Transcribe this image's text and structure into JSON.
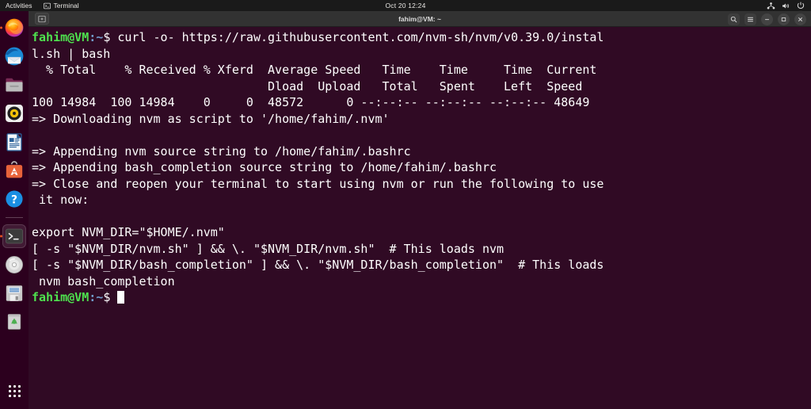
{
  "topbar": {
    "activities": "Activities",
    "app_name": "Terminal",
    "clock": "Oct 20  12:24",
    "indicators": [
      "network-icon",
      "volume-icon",
      "power-icon"
    ]
  },
  "dock": {
    "items": [
      {
        "name": "firefox",
        "label": "Firefox",
        "running": true,
        "active": false
      },
      {
        "name": "thunderbird",
        "label": "Thunderbird",
        "running": false,
        "active": false
      },
      {
        "name": "files",
        "label": "Files",
        "running": false,
        "active": false
      },
      {
        "name": "rhythmbox",
        "label": "Rhythmbox",
        "running": false,
        "active": false
      },
      {
        "name": "libreoffice-writer",
        "label": "LibreOffice Writer",
        "running": false,
        "active": false
      },
      {
        "name": "ubuntu-software",
        "label": "Ubuntu Software",
        "running": false,
        "active": false
      },
      {
        "name": "help",
        "label": "Help",
        "running": false,
        "active": false
      },
      {
        "name": "terminal",
        "label": "Terminal",
        "running": true,
        "active": true
      },
      {
        "name": "disc",
        "label": "Disc",
        "running": false,
        "active": false
      },
      {
        "name": "disks",
        "label": "Disks",
        "running": false,
        "active": false
      },
      {
        "name": "trash",
        "label": "Trash",
        "running": false,
        "active": false
      }
    ],
    "show_apps_label": "Show Applications"
  },
  "window": {
    "title": "fahim@VM: ~",
    "new_tab_label": "New Tab",
    "search_label": "Search",
    "menu_label": "Menu",
    "minimize_label": "–",
    "maximize_label": "❐",
    "close_label": "×"
  },
  "terminal": {
    "prompt_user": "fahim@VM",
    "prompt_path": ":~",
    "prompt_sign": "$ ",
    "command": "curl -o- https://raw.githubusercontent.com/nvm-sh/nvm/v0.39.0/install.sh | bash",
    "output_lines": [
      "  % Total    % Received % Xferd  Average Speed   Time    Time     Time  Current",
      "                                 Dload  Upload   Total   Spent    Left  Speed",
      "100 14984  100 14984    0     0  48572      0 --:--:-- --:--:-- --:--:-- 48649",
      "=> Downloading nvm as script to '/home/fahim/.nvm'",
      "",
      "=> Appending nvm source string to /home/fahim/.bashrc",
      "=> Appending bash_completion source string to /home/fahim/.bashrc",
      "=> Close and reopen your terminal to start using nvm or run the following to use it now:",
      "",
      "export NVM_DIR=\"$HOME/.nvm\"",
      "[ -s \"$NVM_DIR/nvm.sh\" ] && \\. \"$NVM_DIR/nvm.sh\"  # This loads nvm",
      "[ -s \"$NVM_DIR/bash_completion\" ] && \\. \"$NVM_DIR/bash_completion\"  # This loads nvm bash_completion"
    ]
  },
  "colors": {
    "terminal_bg": "#300a24",
    "topbar_bg": "#1a1a1a",
    "titlebar_bg": "#323232",
    "prompt_green": "#4ee24e",
    "prompt_blue": "#729fcf",
    "text_white": "#ffffff",
    "ubuntu_orange": "#e95420"
  }
}
